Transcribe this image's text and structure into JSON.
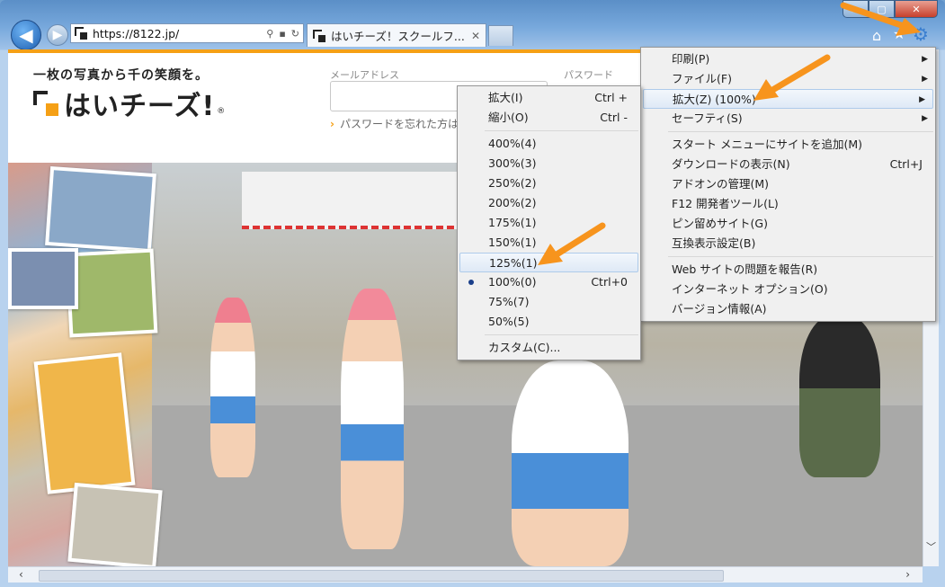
{
  "browser": {
    "url": "https://8122.jp/",
    "tab_title": "はいチーズ！スクールフ...",
    "caption": {
      "min": "▬",
      "max": "▢",
      "close": "✕"
    },
    "icons": {
      "back": "◀",
      "forward": "▶",
      "search": "⚲",
      "lock": "🔒",
      "refresh": "↻",
      "home": "⌂",
      "star": "★",
      "gear": "⚙"
    }
  },
  "site": {
    "tagline": "一枚の写真から千の笑顔を。",
    "logo_text": "はいチーズ!",
    "logo_reg": "®",
    "email_label": "メールアドレス",
    "password_label": "パスワード",
    "forgot_link": "パスワードを忘れた方は"
  },
  "tools_menu": {
    "items": [
      {
        "label": "印刷(P)",
        "submenu": true
      },
      {
        "label": "ファイル(F)",
        "submenu": true
      },
      {
        "label": "拡大(Z) (100%)",
        "submenu": true,
        "highlighted": true
      },
      {
        "label": "セーフティ(S)",
        "submenu": true
      },
      {
        "label": "スタート メニューにサイトを追加(M)"
      },
      {
        "label": "ダウンロードの表示(N)",
        "shortcut": "Ctrl+J"
      },
      {
        "label": "アドオンの管理(M)"
      },
      {
        "label": "F12 開発者ツール(L)"
      },
      {
        "label": "ピン留めサイト(G)"
      },
      {
        "label": "互換表示設定(B)"
      },
      {
        "label": "Web サイトの問題を報告(R)"
      },
      {
        "label": "インターネット オプション(O)"
      },
      {
        "label": "バージョン情報(A)"
      }
    ]
  },
  "zoom_menu": {
    "items": [
      {
        "label": "拡大(I)",
        "shortcut": "Ctrl +"
      },
      {
        "label": "縮小(O)",
        "shortcut": "Ctrl -"
      },
      {
        "label": "400%(4)"
      },
      {
        "label": "300%(3)"
      },
      {
        "label": "250%(2)"
      },
      {
        "label": "200%(2)"
      },
      {
        "label": "175%(1)"
      },
      {
        "label": "150%(1)"
      },
      {
        "label": "125%(1)",
        "highlighted": true
      },
      {
        "label": "100%(0)",
        "shortcut": "Ctrl+0",
        "selected": true
      },
      {
        "label": "75%(7)"
      },
      {
        "label": "50%(5)"
      },
      {
        "label": "カスタム(C)..."
      }
    ]
  },
  "colors": {
    "accent_orange": "#f5a016",
    "menu_bg": "#f0f0f0",
    "annotation_arrow": "#f7941d"
  }
}
